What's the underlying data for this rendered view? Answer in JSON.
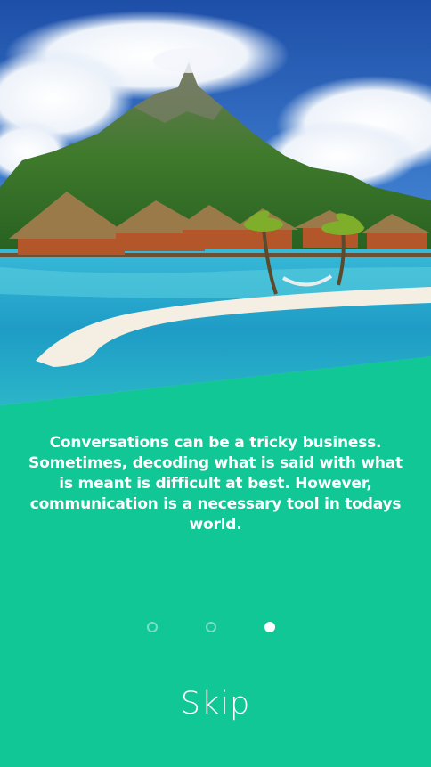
{
  "onboarding": {
    "message": "Conversations can be a tricky business. Sometimes, decoding what is said with what is meant is difficult at best. However, communication is a necessary tool in todays world.",
    "page_indicator": {
      "total": 3,
      "current": 3
    },
    "skip_label": "Skip"
  },
  "colors": {
    "background": "#10c795",
    "text": "#ffffff"
  },
  "hero_image": {
    "icon": "tropical-island-illustration"
  }
}
